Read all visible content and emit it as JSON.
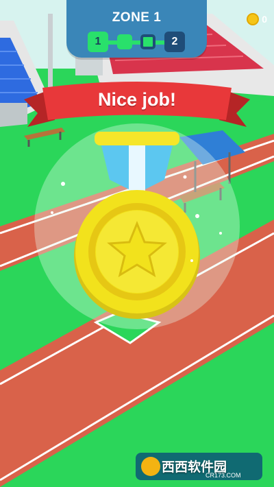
{
  "header": {
    "zone_title": "ZONE 1",
    "stage_start": "1",
    "stage_end": "2"
  },
  "currency": {
    "coins": "0",
    "icon": "coin-icon"
  },
  "reward": {
    "message": "Nice job!",
    "medal_icon": "star-icon"
  },
  "watermark": {
    "brand": "西西软件园",
    "url": "CR173.COM"
  },
  "colors": {
    "panel": "#3a86b8",
    "progress_done": "#29e06b",
    "banner": "#e8383a",
    "medal_gold": "#f2e21c",
    "track": "#d9624a",
    "grass": "#2bd65a"
  }
}
